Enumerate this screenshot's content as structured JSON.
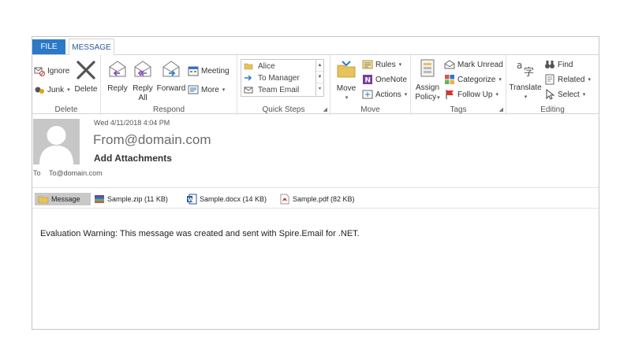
{
  "tabs": {
    "file": "FILE",
    "message": "MESSAGE"
  },
  "ribbon": {
    "delete_group": {
      "ignore": "Ignore",
      "junk": "Junk",
      "delete": "Delete",
      "label": "Delete"
    },
    "respond_group": {
      "reply": "Reply",
      "reply_all_1": "Reply",
      "reply_all_2": "All",
      "forward": "Forward",
      "meeting": "Meeting",
      "more": "More",
      "label": "Respond"
    },
    "quick_steps": {
      "items": [
        "Alice",
        "To Manager",
        "Team Email"
      ],
      "label": "Quick Steps"
    },
    "move_group": {
      "move": "Move",
      "rules": "Rules",
      "onenote": "OneNote",
      "actions": "Actions",
      "label": "Move"
    },
    "tags_group": {
      "assign_1": "Assign",
      "assign_2": "Policy",
      "mark_unread": "Mark Unread",
      "categorize": "Categorize",
      "follow_up": "Follow Up",
      "label": "Tags"
    },
    "editing_group": {
      "translate": "Translate",
      "find": "Find",
      "related": "Related",
      "select": "Select",
      "label": "Editing"
    }
  },
  "message": {
    "date": "Wed 4/11/2018 4:04 PM",
    "from": "From@domain.com",
    "subject": "Add Attachments",
    "to_label": "To",
    "to": "To@domain.com",
    "attachments": [
      {
        "name": "Message"
      },
      {
        "name": "Sample.zip (11 KB)"
      },
      {
        "name": "Sample.docx (14 KB)"
      },
      {
        "name": "Sample.pdf (82 KB)"
      }
    ],
    "body": "Evaluation Warning: This message was created and sent with Spire.Email for .NET."
  },
  "colors": {
    "accent": "#2b79c8",
    "file_tab": "#2b79c8",
    "avatar_bg": "#c7c7c7"
  }
}
